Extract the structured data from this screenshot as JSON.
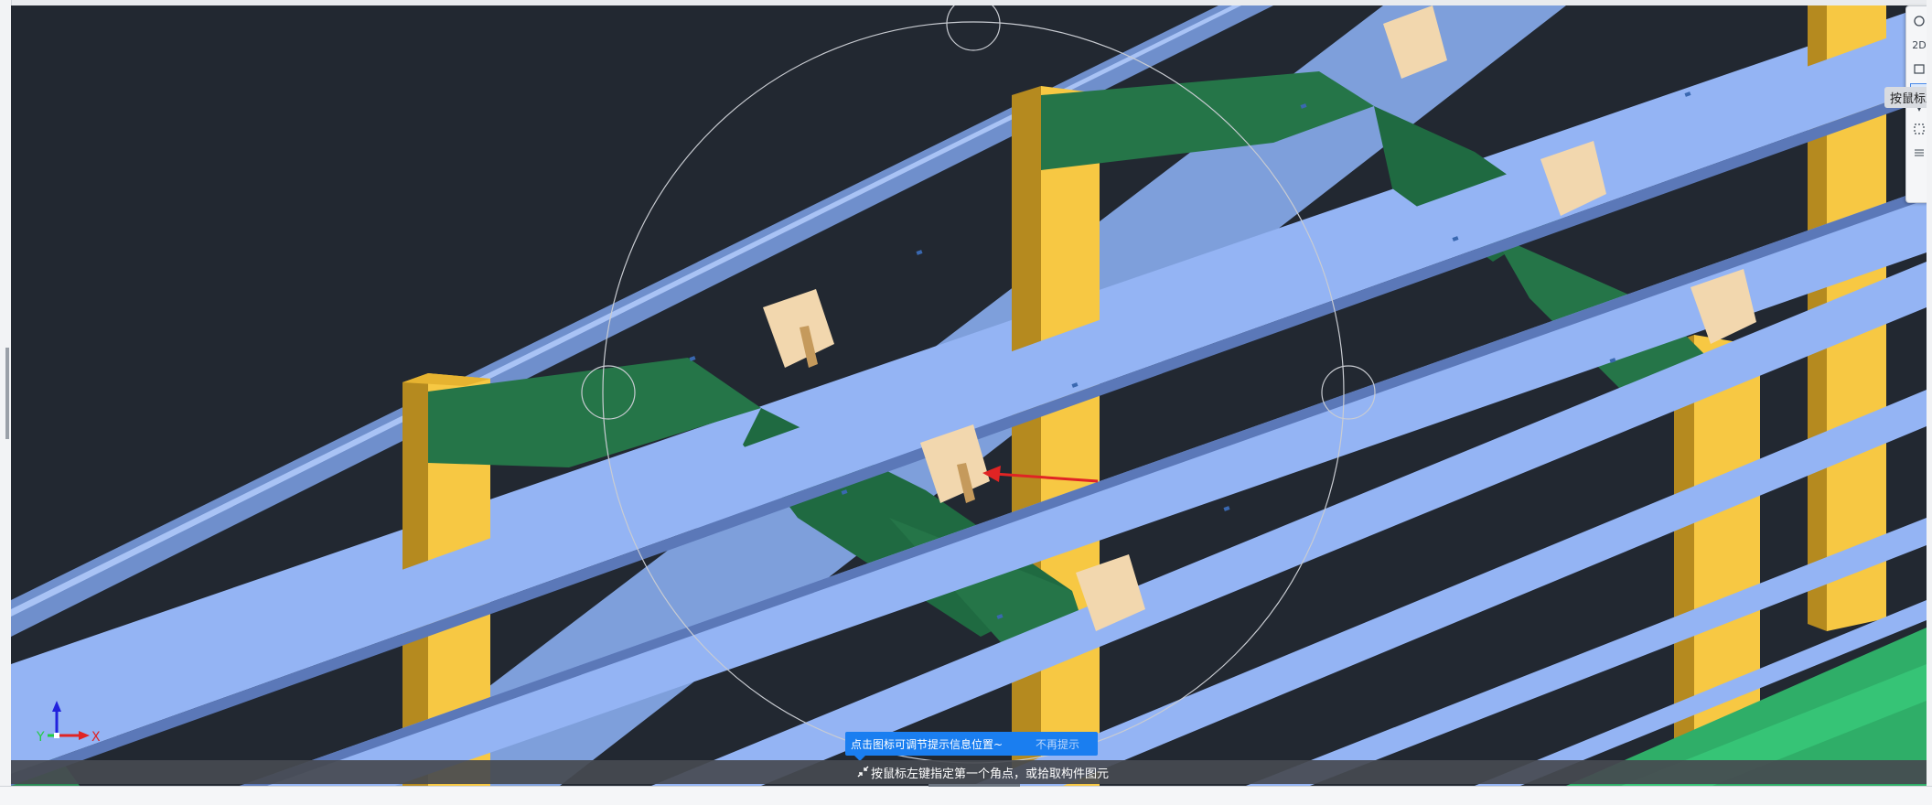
{
  "viewport": {
    "axis_labels": {
      "x": "X",
      "y": "Y"
    }
  },
  "hint": {
    "message": "点击图标可调节提示信息位置~",
    "dismiss": "不再提示"
  },
  "status": {
    "prompt": "按鼠标左键指定第一个角点，或拾取构件图元"
  },
  "side_toolbar": {
    "tooltip": "按鼠标左",
    "buttons": [
      {
        "icon": "orbit-icon"
      },
      {
        "icon": "2d-view-icon",
        "label": "2D"
      },
      {
        "icon": "layer-view-icon"
      },
      {
        "icon": "box-select-icon"
      },
      {
        "icon": "dropdown-caret-icon"
      },
      {
        "icon": "region-select-icon"
      },
      {
        "icon": "properties-list-icon"
      }
    ]
  },
  "colors": {
    "background": "#222831",
    "beam": "#94b4f4",
    "column": "#f7c843",
    "slab": "#257548",
    "bracket": "#f2d7ae",
    "accent": "#1a7ef0",
    "arrow": "#e02424"
  }
}
